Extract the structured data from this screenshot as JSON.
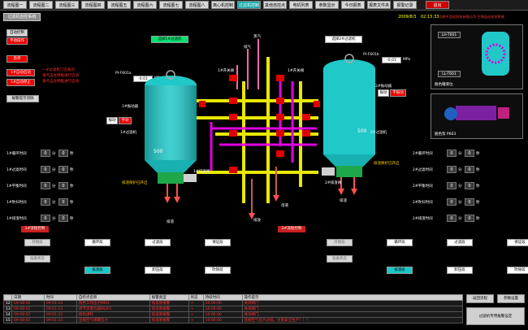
{
  "tabs": [
    {
      "label": "流程图一",
      "state": "normal"
    },
    {
      "label": "流程图二",
      "state": "normal"
    },
    {
      "label": "流程图三",
      "state": "normal"
    },
    {
      "label": "流程图四",
      "state": "normal"
    },
    {
      "label": "流程图五",
      "state": "normal"
    },
    {
      "label": "流程图六",
      "state": "normal"
    },
    {
      "label": "流程图七",
      "state": "normal"
    },
    {
      "label": "流程图八",
      "state": "normal"
    },
    {
      "label": "离心机控制",
      "state": "normal"
    },
    {
      "label": "过滤机控制",
      "state": "active"
    },
    {
      "label": "其他自控点",
      "state": "normal"
    },
    {
      "label": "电机列表",
      "state": "normal"
    },
    {
      "label": "参数显示",
      "state": "normal"
    },
    {
      "label": "今日报表",
      "state": "normal"
    },
    {
      "label": "报表文件夹",
      "state": "normal"
    },
    {
      "label": "报警记录",
      "state": "normal"
    },
    {
      "label": "退出",
      "state": "red"
    }
  ],
  "app_title": "过滤机自控系统",
  "header": {
    "date": "2009/8/3",
    "time": "02:15:33",
    "company": "河南中北化科技有限公司 生物自动化控系统"
  },
  "left_controls": {
    "auto_control": "自动控制",
    "manual_operation": "手动操作",
    "stop": "急停",
    "auto_start": "1#自动启动",
    "auto_stop": "1#自动停止",
    "alarm_reset": "报警提示消除",
    "notes": [
      "一#过滤机门已关闭",
      "请点击左侧框进行启动",
      "请点击左侧框进行启动"
    ]
  },
  "filter_buttons": {
    "select1": "选择1#过滤机",
    "select2": "选择2#过滤机"
  },
  "pressure": [
    {
      "label": "PI-F601a",
      "value": "-0.01",
      "unit": "MPa"
    },
    {
      "label": "PI-F601b",
      "value": "-0.01",
      "unit": "MPa"
    }
  ],
  "vessel_labels": [
    "1#过滤机",
    "2#过滤机",
    "500",
    "500"
  ],
  "valve_labels": [
    "1#振动器",
    "2#振动器",
    "1#开关阀",
    "1#开关阀",
    "1#排渣阀",
    "1#排渣阀",
    "2#排渣阀",
    "1#排渣阀",
    "1#排渣阀"
  ],
  "pipe_labels": [
    "蒸汽",
    "排气",
    "放空",
    "排放",
    "母液",
    "排污",
    "排渣"
  ],
  "manual_tags": [
    {
      "label": "振动",
      "state": "手动"
    },
    {
      "label": "振动",
      "state": "不振动"
    }
  ],
  "protection_notes": [
    "排渣保护已开启",
    "排渣保护已开启"
  ],
  "timers_left": [
    {
      "label": "1#循环时间",
      "min": "0",
      "sec": "0"
    },
    {
      "label": "1#过滤时间",
      "min": "0",
      "sec": "0"
    },
    {
      "label": "1#平衡时间",
      "min": "0",
      "sec": "0"
    },
    {
      "label": "1#吹扫时间",
      "min": "0",
      "sec": "0"
    },
    {
      "label": "1#排渣时间",
      "min": "0",
      "sec": "0"
    }
  ],
  "timers_right": [
    {
      "label": "2#循环时间",
      "min": "0",
      "sec": "0"
    },
    {
      "label": "2#过滤时间",
      "min": "0",
      "sec": "0"
    },
    {
      "label": "2#平衡时间",
      "min": "0",
      "sec": "0"
    },
    {
      "label": "2#吹扫时间",
      "min": "0",
      "sec": "0"
    },
    {
      "label": "2#排渣时间",
      "min": "0",
      "sec": "0"
    }
  ],
  "timer_units": {
    "min": "分",
    "sec": "秒"
  },
  "right_panels": [
    {
      "title": "脱色罐液位",
      "tags": [
        "LH-T601",
        "LL-T601"
      ]
    },
    {
      "title": "脱色泵 P603",
      "tags": []
    }
  ],
  "flow1": {
    "title": "1#流程控制",
    "row1": [
      "开始段",
      "循环段",
      "过滤段",
      "保证段"
    ],
    "row2": [
      "准备状态",
      "排渣段",
      "卸压段",
      "吹除段"
    ]
  },
  "flow2": {
    "title": "2#流程控制",
    "row1": [
      "开始段",
      "循环段",
      "过滤段",
      "保证段"
    ],
    "row2": [
      "准备状态",
      "排渣段",
      "卸压段",
      "吹除段"
    ]
  },
  "alarm_table": {
    "headers": [
      "",
      "日期",
      "时间",
      "自控点名称",
      "报警类型",
      "状态",
      "持续时间",
      "操作提示"
    ],
    "rows": [
      [
        "12",
        "09-08-02",
        "09:01:23",
        "脱色工作压力MI01",
        "低低限报警",
        "+",
        "10:00:00",
        "关闭阀门"
      ],
      [
        "13",
        "09-08-02",
        "09:01:23",
        "调节流量位器MJ301",
        "低低限报警",
        "+",
        "10:00:00",
        "关闭阀门"
      ],
      [
        "14",
        "09-08-02",
        "09:01:23",
        "脱色进料",
        "低低限报警",
        "+",
        "10:00:00",
        "关闭阀门"
      ],
      [
        "15",
        "09-08-02",
        "09:01:23",
        "压缩空气储罐压力",
        "低低限报警",
        "+",
        "10:00:00",
        "压缩空气压力过低，注意安全生产！！！"
      ]
    ]
  },
  "bottom_buttons": {
    "return": "返回流程",
    "params": "参数设置",
    "filter_params": "过滤机专用报警设定"
  }
}
